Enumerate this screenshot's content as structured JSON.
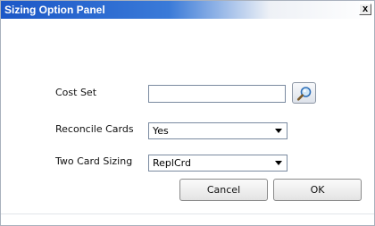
{
  "window": {
    "title": "Sizing Option Panel",
    "close_label": "x"
  },
  "form": {
    "cost_set": {
      "label": "Cost Set",
      "value": "",
      "lookup_icon": "magnifier-icon"
    },
    "reconcile_cards": {
      "label": "Reconcile Cards",
      "selected": "Yes"
    },
    "two_card_sizing": {
      "label": "Two Card Sizing",
      "selected": "ReplCrd"
    }
  },
  "buttons": {
    "cancel_label": "Cancel",
    "ok_label": "OK"
  },
  "colors": {
    "titlebar_start": "#1b57c7",
    "titlebar_mid": "#3a7ad8",
    "titlebar_end": "#ffffff",
    "title_text": "#ffffff"
  }
}
